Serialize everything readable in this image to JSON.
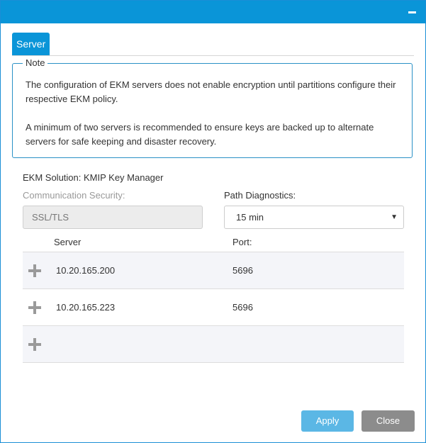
{
  "tabs": [
    {
      "label": "Server",
      "active": true
    }
  ],
  "note": {
    "legend": "Note",
    "paragraphs": [
      "The configuration of EKM servers does not enable encryption until partitions configure their respective EKM policy.",
      "A minimum of two servers is recommended to ensure keys are backed up to alternate servers for safe keeping and disaster recovery."
    ]
  },
  "ekm_solution": "EKM Solution: KMIP Key Manager",
  "communication_security": {
    "label": "Communication Security:",
    "value": "SSL/TLS"
  },
  "path_diagnostics": {
    "label": "Path Diagnostics:",
    "value": "15 min"
  },
  "server_table": {
    "columns": [
      "Server",
      "Port:"
    ],
    "rows": [
      {
        "server": "10.20.165.200",
        "port": "5696"
      },
      {
        "server": "10.20.165.223",
        "port": "5696"
      },
      {
        "server": "",
        "port": ""
      }
    ]
  },
  "buttons": {
    "apply": "Apply",
    "close": "Close"
  },
  "icons": {
    "add": "plus-icon",
    "minimize": "minimize-icon",
    "dropdown": "caret-down-icon"
  },
  "colors": {
    "accent": "#0a95d8",
    "apply": "#5bb7e5",
    "close": "#8c8c8c",
    "plus": "#9a9a9a"
  }
}
